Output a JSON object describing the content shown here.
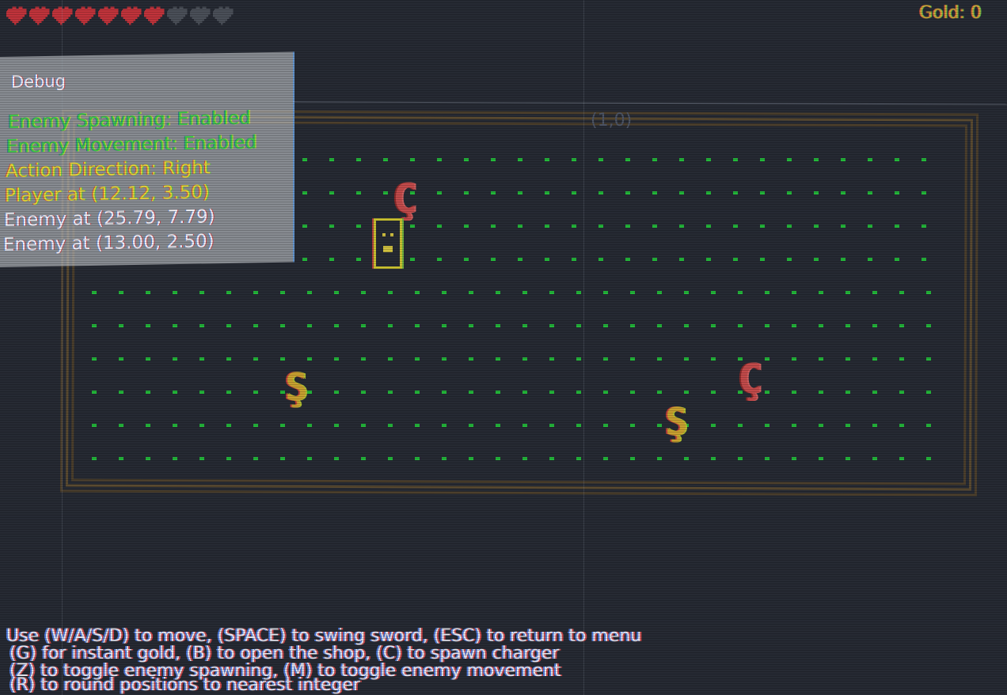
{
  "hud": {
    "hearts_total": 10,
    "hearts_filled": 7,
    "heart_color_full": "#c0333b",
    "heart_color_empty": "#4a4f58",
    "gold_text": "Gold: 0"
  },
  "debug": {
    "title": "Debug",
    "lines": [
      "Enemy Spawning: Enabled",
      "Enemy Movement: Enabled",
      "Action Direction: Right",
      "Player at (12.12, 3.50)",
      "Enemy at (25.79, 7.79)",
      "Enemy at (13.00, 2.50)"
    ]
  },
  "arena": {
    "room_label": "(1,0)",
    "floor_color": "#23b83a",
    "border_color": "#5a4a30"
  },
  "sprites": {
    "player_glyph": "player",
    "charger_glyph": "Ç",
    "slime_glyph": "Ş"
  },
  "help": {
    "lines": [
      "Use (W/A/S/D) to move, (SPACE) to swing sword, (ESC) to return to menu",
      "(G) for instant gold, (B) to open the shop, (C) to spawn charger",
      "(Z) to toggle enemy spawning, (M) to toggle enemy movement",
      "(R) to round positions to nearest integer"
    ]
  }
}
